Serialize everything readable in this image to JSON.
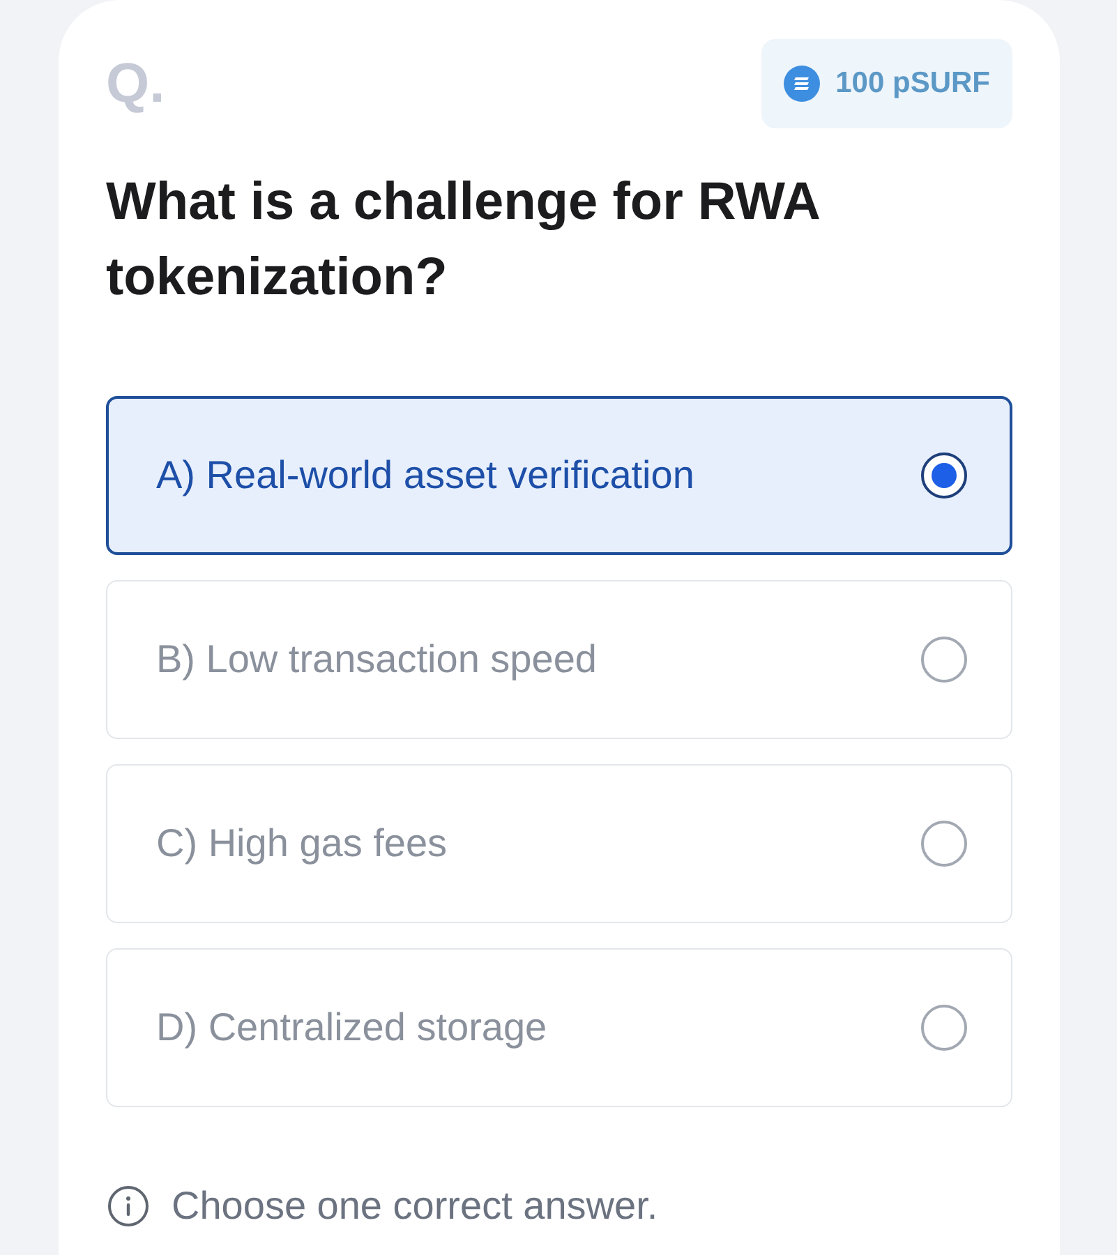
{
  "header": {
    "label": "Q.",
    "reward": "100 pSURF"
  },
  "question": "What is a challenge for RWA tokenization?",
  "options": [
    {
      "label": "A) Real-world asset verification",
      "selected": true
    },
    {
      "label": "B) Low transaction speed",
      "selected": false
    },
    {
      "label": "C) High gas fees",
      "selected": false
    },
    {
      "label": "D) Centralized storage",
      "selected": false
    }
  ],
  "hint": "Choose one correct answer."
}
